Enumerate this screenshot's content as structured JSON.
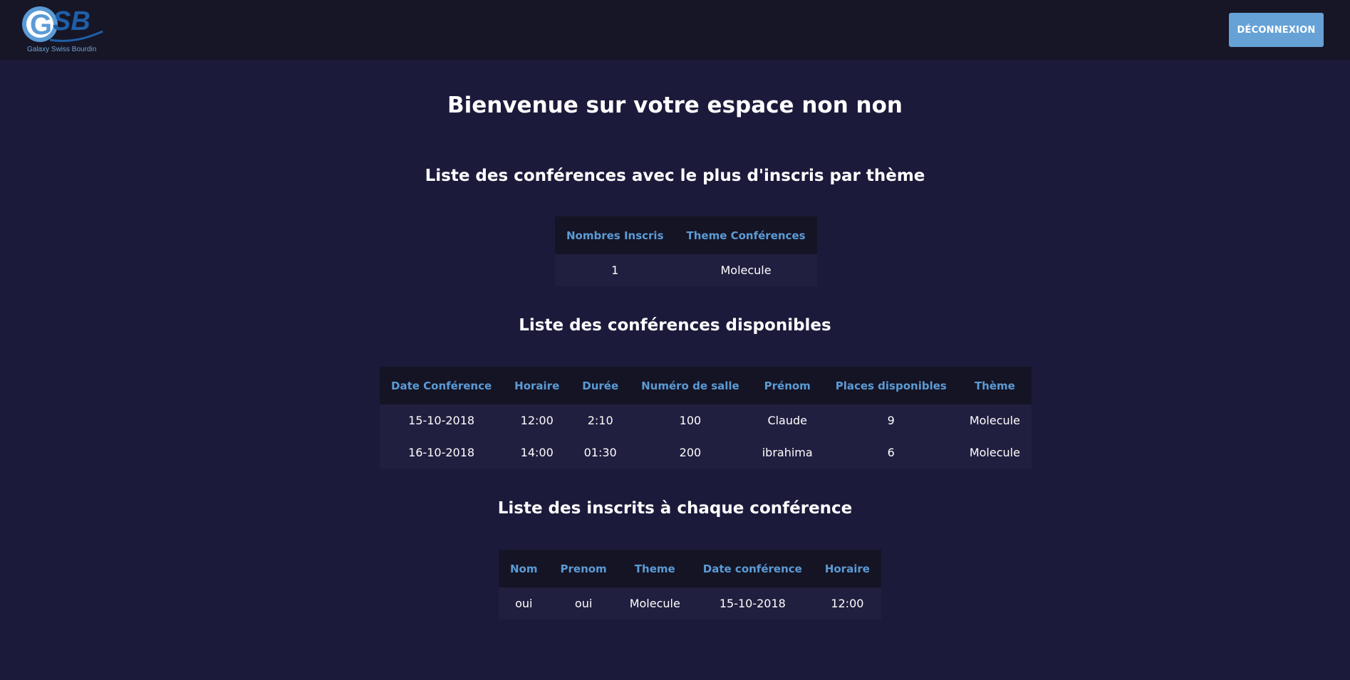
{
  "header": {
    "logo_text": "GSB",
    "logo_caption": "Galaxy Swiss Bourdin",
    "logout_label": "DÉCONNEXION"
  },
  "page": {
    "title": "Bienvenue sur votre espace non non"
  },
  "section1": {
    "title": "Liste des conférences avec le plus d'inscris par thème",
    "columns": [
      "Nombres Inscris",
      "Theme Conférences"
    ],
    "rows": [
      [
        "1",
        "Molecule"
      ]
    ]
  },
  "section2": {
    "title": "Liste des conférences disponibles",
    "columns": [
      "Date Conférence",
      "Horaire",
      "Durée",
      "Numéro de salle",
      "Prénom",
      "Places disponibles",
      "Thème"
    ],
    "rows": [
      [
        "15-10-2018",
        "12:00",
        "2:10",
        "100",
        "Claude",
        "9",
        "Molecule"
      ],
      [
        "16-10-2018",
        "14:00",
        "01:30",
        "200",
        "ibrahima",
        "6",
        "Molecule"
      ]
    ]
  },
  "section3": {
    "title": "Liste des inscrits à chaque conférence",
    "columns": [
      "Nom",
      "Prenom",
      "Theme",
      "Date conférence",
      "Horaire"
    ],
    "rows": [
      [
        "oui",
        "oui",
        "Molecule",
        "15-10-2018",
        "12:00"
      ]
    ]
  },
  "colors": {
    "background": "#1c1a3b",
    "topbar": "#171626",
    "accent": "#5b9bd5",
    "button": "#66a2d6"
  }
}
